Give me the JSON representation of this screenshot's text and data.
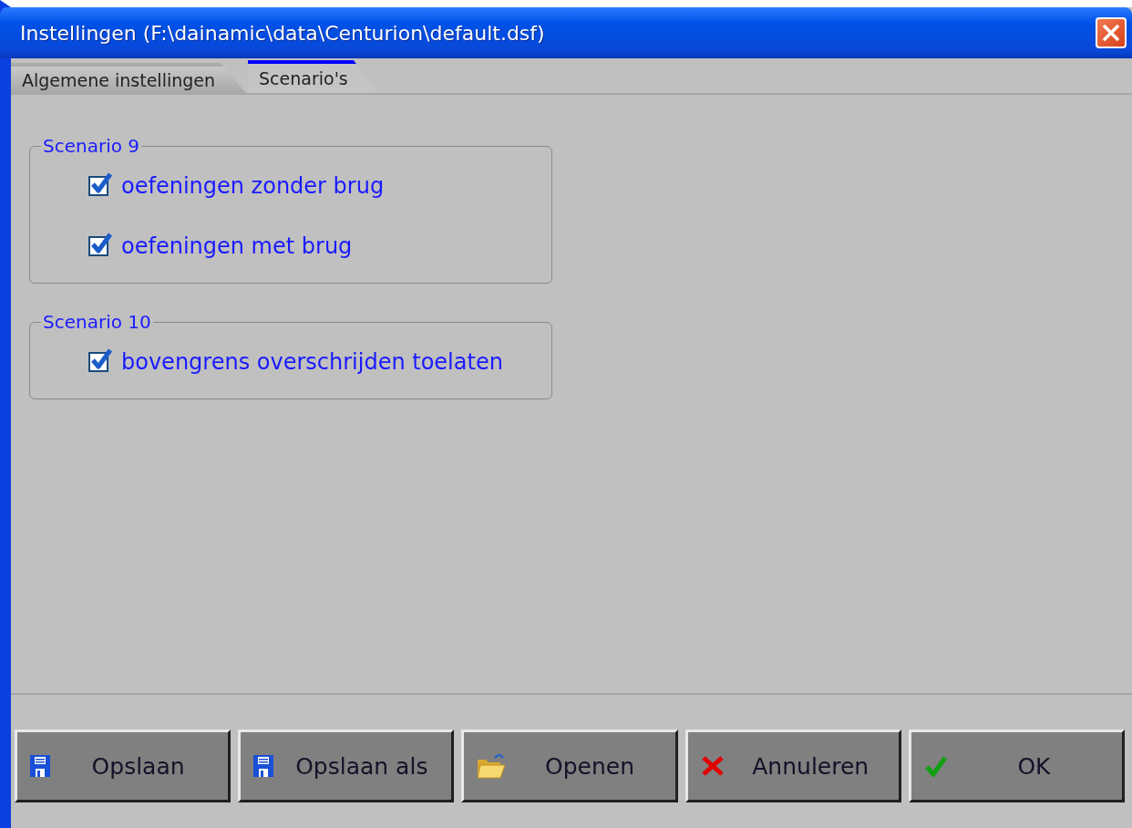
{
  "window": {
    "title": "Instellingen (F:\\dainamic\\data\\Centurion\\default.dsf)"
  },
  "tabs": [
    {
      "label": "Algemene instellingen",
      "selected": false
    },
    {
      "label": "Scenario's",
      "selected": true
    }
  ],
  "groups": [
    {
      "title": "Scenario 9",
      "options": [
        {
          "label": "oefeningen zonder brug",
          "checked": true
        },
        {
          "label": "oefeningen met brug",
          "checked": true
        }
      ]
    },
    {
      "title": "Scenario 10",
      "options": [
        {
          "label": "bovengrens overschrijden toelaten",
          "checked": true
        }
      ]
    }
  ],
  "buttons": [
    {
      "label": "Opslaan",
      "kind": "save"
    },
    {
      "label": "Opslaan als",
      "kind": "save"
    },
    {
      "label": "Openen",
      "kind": "open"
    },
    {
      "label": "Annuleren",
      "kind": "cancel"
    },
    {
      "label": "OK",
      "kind": "confirm"
    }
  ]
}
